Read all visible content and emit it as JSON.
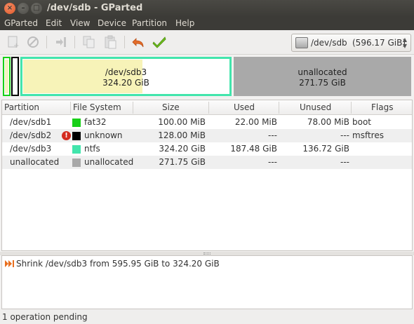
{
  "window": {
    "title": "/dev/sdb - GParted"
  },
  "menu": [
    "GParted",
    "Edit",
    "View",
    "Device",
    "Partition",
    "Help"
  ],
  "toolbar": {
    "icons": [
      "new-icon",
      "delete-icon",
      "resize-move-icon",
      "copy-icon",
      "paste-icon",
      "undo-icon",
      "apply-icon"
    ]
  },
  "device_selector": {
    "name": "/dev/sdb",
    "size": "(596.17 GiB)"
  },
  "map": {
    "main": {
      "name": "/dev/sdb3",
      "size": "324.20 GiB"
    },
    "unalloc": {
      "name": "unallocated",
      "size": "271.75 GiB"
    }
  },
  "table": {
    "headers": [
      "Partition",
      "File System",
      "Size",
      "Used",
      "Unused",
      "Flags"
    ],
    "rows": [
      {
        "partition": "/dev/sdb1",
        "fs": "fat32",
        "color": "#18d018",
        "size": "100.00 MiB",
        "used": "22.00 MiB",
        "unused": "78.00 MiB",
        "flags": "boot",
        "warn": false
      },
      {
        "partition": "/dev/sdb2",
        "fs": "unknown",
        "color": "#000000",
        "size": "128.00 MiB",
        "used": "---",
        "unused": "---",
        "flags": "msftres",
        "warn": true
      },
      {
        "partition": "/dev/sdb3",
        "fs": "ntfs",
        "color": "#42e5ac",
        "size": "324.20 GiB",
        "used": "187.48 GiB",
        "unused": "136.72 GiB",
        "flags": "",
        "warn": false
      },
      {
        "partition": "unallocated",
        "fs": "unallocated",
        "color": "#a9a9a9",
        "size": "271.75 GiB",
        "used": "---",
        "unused": "---",
        "flags": "",
        "warn": false
      }
    ]
  },
  "pending": {
    "operations": [
      "Shrink /dev/sdb3 from 595.95 GiB to 324.20 GiB"
    ]
  },
  "status": "1 operation pending"
}
